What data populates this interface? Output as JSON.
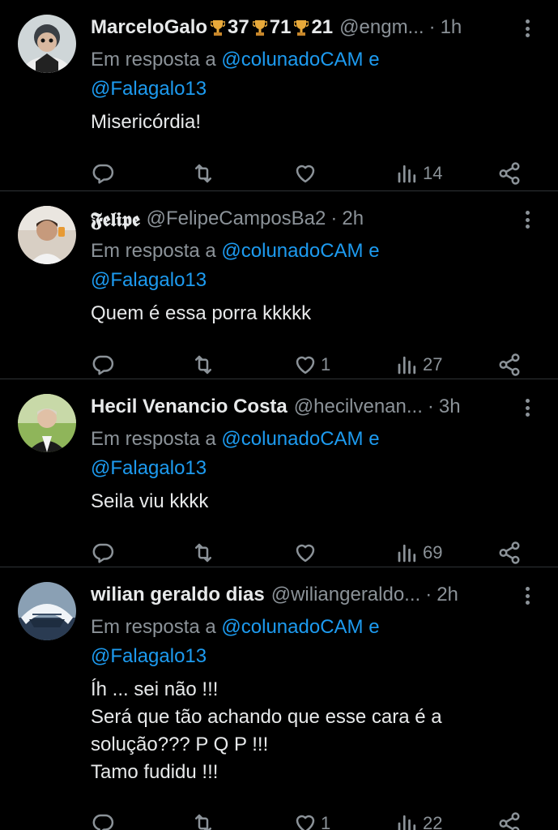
{
  "tweets": [
    {
      "name": "MarceloGalo",
      "badges": [
        "37",
        "71",
        "21"
      ],
      "handle": "@engm...",
      "sep": "·",
      "time": "1h",
      "reply_prefix": "Em resposta a",
      "mention1": "@colunadoCAM",
      "reply_and": "e",
      "mention2": "@Falagalo13",
      "text": "Misericórdia!",
      "likes": "",
      "views": "14"
    },
    {
      "name": "𝕱𝖊𝖑𝖎𝖕𝖊",
      "handle": "@FelipeCamposBa2",
      "sep": "·",
      "time": "2h",
      "reply_prefix": "Em resposta a",
      "mention1": "@colunadoCAM",
      "reply_and": "e",
      "mention2": "@Falagalo13",
      "text": "Quem é essa porra kkkkk",
      "likes": "1",
      "views": "27"
    },
    {
      "name": "Hecil Venancio Costa",
      "handle": "@hecilvenan...",
      "sep": "·",
      "time": "3h",
      "reply_prefix": "Em resposta a",
      "mention1": "@colunadoCAM",
      "reply_and": "e",
      "mention2": "@Falagalo13",
      "text": "Seila viu kkkk",
      "likes": "",
      "views": "69"
    },
    {
      "name": "wilian geraldo dias",
      "handle": "@wiliangeraldo...",
      "sep": "·",
      "time": "2h",
      "reply_prefix": "Em resposta a",
      "mention1": "@colunadoCAM",
      "reply_and": "e",
      "mention2": "@Falagalo13",
      "text": "Íh ... sei não !!!\nSerá que tão achando que esse cara é a solução???  P Q P  !!!\nTamo fudidu !!!",
      "likes": "1",
      "views": "22"
    }
  ],
  "icons": {
    "reply": "reply-icon",
    "retweet": "retweet-icon",
    "like": "heart-icon",
    "views": "views-icon",
    "share": "share-icon",
    "more": "more-icon"
  },
  "colors": {
    "background": "#000000",
    "text": "#e7e9ea",
    "muted": "#8b9298",
    "link": "#1d9bf0",
    "divider": "#2f3336",
    "trophy": "#e8a93a"
  }
}
